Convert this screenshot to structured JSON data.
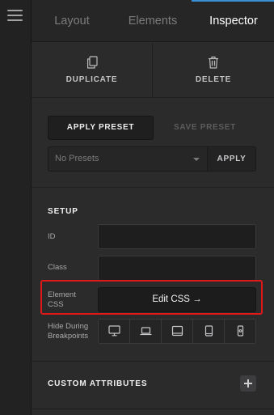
{
  "tabs": [
    {
      "label": "Layout",
      "active": false
    },
    {
      "label": "Elements",
      "active": false
    },
    {
      "label": "Inspector",
      "active": true
    }
  ],
  "colors": {
    "accent": "#3b8fd6",
    "highlight": "#e01818",
    "panel": "#2b2b2c"
  },
  "actions": {
    "duplicate": {
      "label": "DUPLICATE",
      "icon": "duplicate-icon"
    },
    "delete": {
      "label": "DELETE",
      "icon": "trash-icon"
    }
  },
  "presets": {
    "apply_preset_label": "APPLY PRESET",
    "save_preset_label": "SAVE PRESET",
    "selected": "No Presets",
    "apply_label": "APPLY"
  },
  "setup": {
    "title": "SETUP",
    "id_label": "ID",
    "id_value": "",
    "class_label": "Class",
    "class_value": "",
    "element_css_label_1": "Element",
    "element_css_label_2": "CSS",
    "edit_css_label": "Edit CSS →",
    "breakpoints_label_1": "Hide During",
    "breakpoints_label_2": "Breakpoints",
    "breakpoints": [
      "desktop-icon",
      "laptop-icon",
      "tablet-landscape-icon",
      "tablet-portrait-icon",
      "phone-icon"
    ]
  },
  "custom_attributes": {
    "title": "CUSTOM ATTRIBUTES",
    "icon": "plus-icon"
  }
}
